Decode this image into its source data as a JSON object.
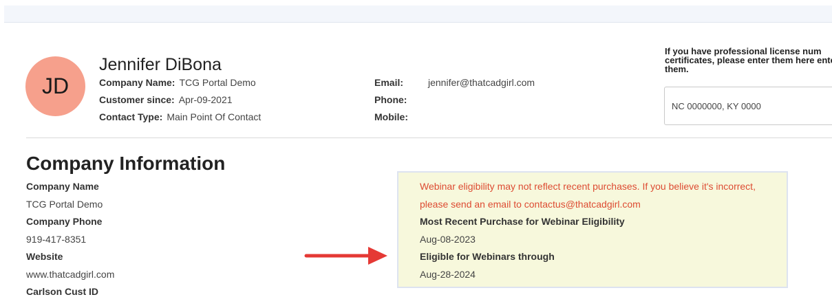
{
  "profile": {
    "initials": "JD",
    "name": "Jennifer DiBona",
    "company_label": "Company Name:",
    "company_value": "TCG Portal Demo",
    "customer_since_label": "Customer since:",
    "customer_since_value": "Apr-09-2021",
    "contact_type_label": "Contact Type:",
    "contact_type_value": "Main Point Of Contact",
    "email_label": "Email:",
    "email_value": "jennifer@thatcadgirl.com",
    "phone_label": "Phone:",
    "phone_value": "",
    "mobile_label": "Mobile:",
    "mobile_value": ""
  },
  "license": {
    "prompt": "If you have professional license num certificates, please enter them here enter them.",
    "value": "NC 0000000, KY 0000"
  },
  "company_info": {
    "title": "Company Information",
    "fields": [
      {
        "label": "Company Name",
        "value": "TCG Portal Demo"
      },
      {
        "label": "Company Phone",
        "value": "919-417-8351"
      },
      {
        "label": "Website",
        "value": "www.thatcadgirl.com"
      },
      {
        "label": "Carlson Cust ID",
        "value": ""
      }
    ]
  },
  "webinar": {
    "warning_line1": "Webinar eligibility may not reflect recent purchases. If you believe it's incorrect,",
    "warning_line2": "please send an email to contactus@thatcadgirl.com",
    "recent_purchase_label": "Most Recent Purchase for Webinar Eligibility",
    "recent_purchase_value": "Aug-08-2023",
    "eligible_label": "Eligible for Webinars through",
    "eligible_value": "Aug-28-2024"
  },
  "colors": {
    "avatar": "#f6a08c",
    "warning_text": "#dd4b32",
    "notice_bg": "#f7f8dc",
    "arrow": "#e53935"
  }
}
